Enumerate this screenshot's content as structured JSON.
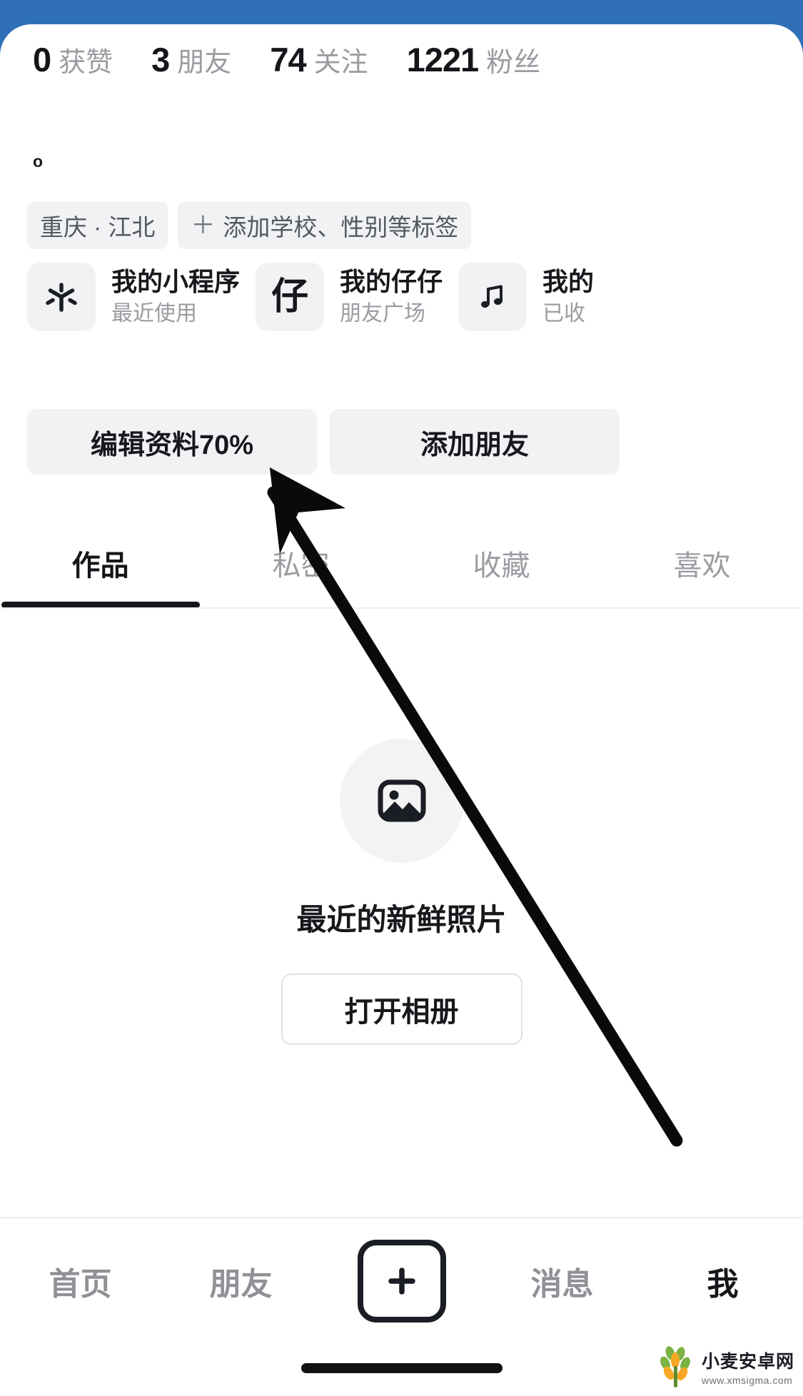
{
  "theme": {
    "status_bar_color": "#2f6fb8",
    "sheet_color": "#ffffff",
    "muted_text": "#9a9ca1",
    "primary_text": "#15161a",
    "chip_bg": "#f1f2f4"
  },
  "stats": [
    {
      "num": "0",
      "label": "获赞",
      "name": "likes"
    },
    {
      "num": "3",
      "label": "朋友",
      "name": "friends"
    },
    {
      "num": "74",
      "label": "关注",
      "name": "following"
    },
    {
      "num": "1221",
      "label": "粉丝",
      "name": "followers"
    }
  ],
  "bio": "o",
  "tags": [
    {
      "icon": "",
      "label": "重庆 · 江北",
      "name": "location-tag"
    },
    {
      "icon": "＋",
      "label": "添加学校、性别等标签",
      "name": "add-tag"
    }
  ],
  "mini_cards": [
    {
      "icon": "asterisk-icon",
      "glyph": "",
      "title": "我的小程序",
      "subtitle": "最近使用"
    },
    {
      "icon": "zaizai-icon",
      "glyph": "仔",
      "title": "我的仔仔",
      "subtitle": "朋友广场"
    },
    {
      "icon": "music-icon",
      "glyph": "♫",
      "title": "我的",
      "subtitle": "已收"
    }
  ],
  "actions": [
    {
      "label": "编辑资料70%",
      "name": "edit-profile-button"
    },
    {
      "label": "添加朋友",
      "name": "add-friend-button"
    }
  ],
  "tabs": [
    {
      "label": "作品",
      "active": true
    },
    {
      "label": "私密",
      "active": false
    },
    {
      "label": "收藏",
      "active": false
    },
    {
      "label": "喜欢",
      "active": false
    }
  ],
  "empty_state": {
    "icon": "image-placeholder-icon",
    "text": "最近的新鲜照片",
    "button_label": "打开相册"
  },
  "bottom_nav": [
    {
      "label": "首页",
      "active": false,
      "name": "nav-home"
    },
    {
      "label": "朋友",
      "active": false,
      "name": "nav-friends"
    },
    {
      "label": "+",
      "active": false,
      "name": "nav-create",
      "is_plus": true
    },
    {
      "label": "消息",
      "active": false,
      "name": "nav-messages"
    },
    {
      "label": "我",
      "active": true,
      "name": "nav-me"
    }
  ],
  "watermark": {
    "title": "小麦安卓网",
    "url": "www.xmsigma.com"
  }
}
